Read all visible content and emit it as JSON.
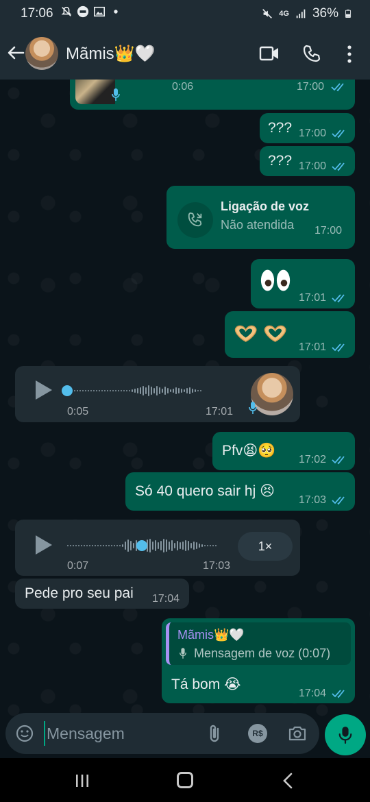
{
  "status_bar": {
    "time": "17:06",
    "network": "4G",
    "battery": "36%",
    "icons": [
      "muted-bell-icon",
      "uber-icon",
      "image-icon",
      "dot-icon",
      "mute-icon",
      "signal-icon",
      "battery-icon"
    ]
  },
  "header": {
    "contact_name": "Mãmis👑🤍",
    "icons": [
      "back-arrow-icon",
      "video-call-icon",
      "voice-call-icon",
      "more-options-icon"
    ]
  },
  "messages": {
    "top_voice": {
      "duration": "0:06",
      "time": "17:00"
    },
    "q1": {
      "text": "???",
      "time": "17:00"
    },
    "q2": {
      "text": "???",
      "time": "17:00"
    },
    "call": {
      "title": "Ligação de voz",
      "status": "Não atendida",
      "time": "17:00"
    },
    "eyes": {
      "text": "👀",
      "time": "17:01"
    },
    "hearts": {
      "text": "🫶🫶",
      "time": "17:01"
    },
    "in_voice": {
      "duration": "0:05",
      "time": "17:01"
    },
    "pfv": {
      "text": "Pfv😫🥺",
      "time": "17:02"
    },
    "so40": {
      "text": "Só 40 quero sair hj 😣",
      "time": "17:03"
    },
    "in_voice2": {
      "duration": "0:07",
      "time": "17:03",
      "speed": "1×"
    },
    "pede": {
      "text": "Pede pro seu pai",
      "time": "17:04"
    },
    "reply": {
      "quoted_name": "Mãmis👑🤍",
      "quoted_text": "Mensagem de voz (0:07)",
      "text": "Tá bom 😭",
      "time": "17:04"
    }
  },
  "input": {
    "placeholder": "Mensagem",
    "pay_label": "R$"
  },
  "colors": {
    "outgoing_bubble": "#005c4b",
    "incoming_bubble": "#202c33",
    "read_ticks": "#53bdeb",
    "accent": "#00a884"
  }
}
